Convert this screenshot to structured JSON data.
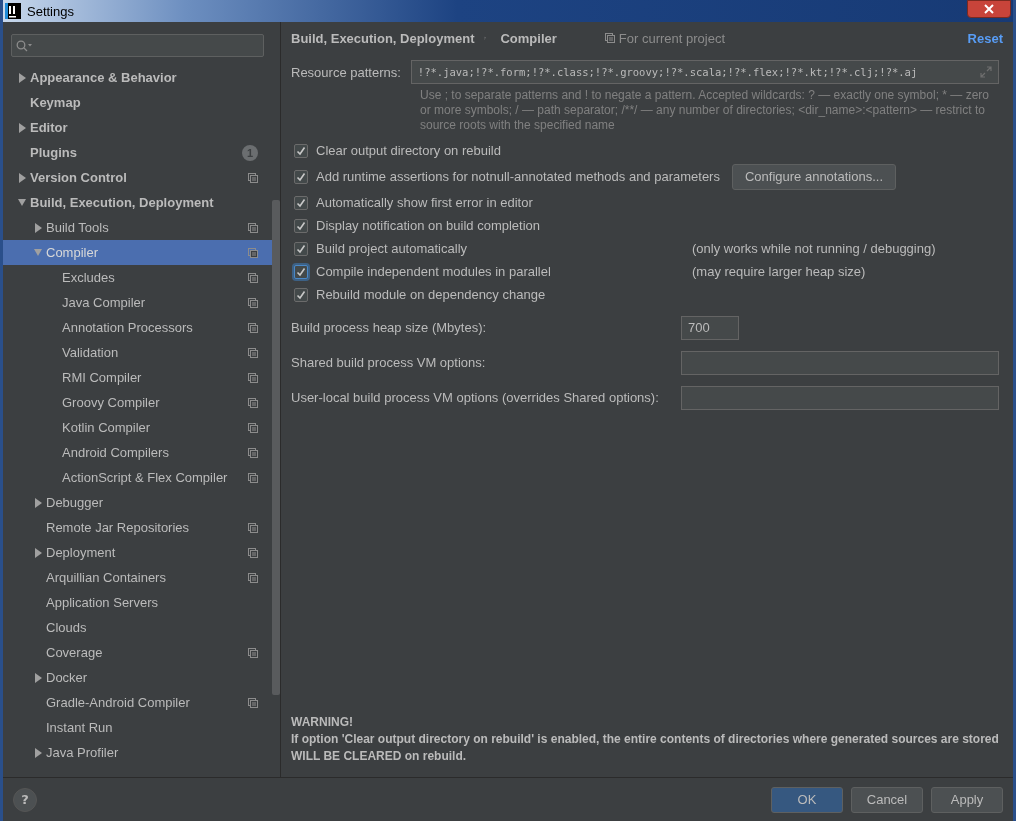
{
  "window": {
    "title": "Settings"
  },
  "sidebar": {
    "items": [
      {
        "label": "Appearance & Behavior",
        "expanded": false,
        "selected": false
      },
      {
        "label": "Keymap",
        "selected": false
      },
      {
        "label": "Editor",
        "expanded": false,
        "selected": false
      },
      {
        "label": "Plugins",
        "badge": "1",
        "selected": false
      },
      {
        "label": "Version Control",
        "expanded": false,
        "per_project": true,
        "selected": false
      },
      {
        "label": "Build, Execution, Deployment",
        "expanded": true,
        "selected": false,
        "children": [
          {
            "label": "Build Tools",
            "expanded": false,
            "per_project": true,
            "selected": false
          },
          {
            "label": "Compiler",
            "expanded": true,
            "per_project": true,
            "selected": true,
            "children": [
              {
                "label": "Excludes",
                "per_project": true,
                "selected": false
              },
              {
                "label": "Java Compiler",
                "per_project": true,
                "selected": false
              },
              {
                "label": "Annotation Processors",
                "per_project": true,
                "selected": false
              },
              {
                "label": "Validation",
                "per_project": true,
                "selected": false
              },
              {
                "label": "RMI Compiler",
                "per_project": true,
                "selected": false
              },
              {
                "label": "Groovy Compiler",
                "per_project": true,
                "selected": false
              },
              {
                "label": "Kotlin Compiler",
                "per_project": true,
                "selected": false
              },
              {
                "label": "Android Compilers",
                "per_project": true,
                "selected": false
              },
              {
                "label": "ActionScript & Flex Compiler",
                "per_project": true,
                "selected": false
              }
            ]
          },
          {
            "label": "Debugger",
            "expanded": false,
            "selected": false
          },
          {
            "label": "Remote Jar Repositories",
            "per_project": true,
            "selected": false
          },
          {
            "label": "Deployment",
            "expanded": false,
            "per_project": true,
            "selected": false
          },
          {
            "label": "Arquillian Containers",
            "per_project": true,
            "selected": false
          },
          {
            "label": "Application Servers",
            "selected": false
          },
          {
            "label": "Clouds",
            "selected": false
          },
          {
            "label": "Coverage",
            "per_project": true,
            "selected": false
          },
          {
            "label": "Docker",
            "expanded": false,
            "selected": false
          },
          {
            "label": "Gradle-Android Compiler",
            "per_project": true,
            "selected": false
          },
          {
            "label": "Instant Run",
            "selected": false
          },
          {
            "label": "Java Profiler",
            "expanded": false,
            "selected": false
          }
        ]
      }
    ]
  },
  "breadcrumb": [
    "Build, Execution, Deployment",
    "Compiler"
  ],
  "scope": "For current project",
  "reset": "Reset",
  "resource_patterns": {
    "label": "Resource patterns:",
    "value": "!?*.java;!?*.form;!?*.class;!?*.groovy;!?*.scala;!?*.flex;!?*.kt;!?*.clj;!?*.aj",
    "hint": "Use ; to separate patterns and ! to negate a pattern. Accepted wildcards: ? — exactly one symbol; * — zero or more symbols; / — path separator; /**/ — any number of directories; <dir_name>:<pattern> — restrict to source roots with the specified name"
  },
  "options": [
    {
      "label": "Clear output directory on rebuild",
      "checked": true,
      "focused": false
    },
    {
      "label": "Add runtime assertions for notnull-annotated methods and parameters",
      "checked": true,
      "focused": false,
      "button": "Configure annotations..."
    },
    {
      "label": "Automatically show first error in editor",
      "checked": true,
      "focused": false
    },
    {
      "label": "Display notification on build completion",
      "checked": true,
      "focused": false
    },
    {
      "label": "Build project automatically",
      "checked": true,
      "focused": false,
      "note": "(only works while not running / debugging)"
    },
    {
      "label": "Compile independent modules in parallel",
      "checked": true,
      "focused": true,
      "note": "(may require larger heap size)"
    },
    {
      "label": "Rebuild module on dependency change",
      "checked": true,
      "focused": false
    }
  ],
  "fields": [
    {
      "label": "Build process heap size (Mbytes):",
      "value": "700",
      "kind": "short"
    },
    {
      "label": "Shared build process VM options:",
      "kind": "wide"
    },
    {
      "label": "User-local build process VM options (overrides Shared options):",
      "kind": "wide"
    }
  ],
  "warning": {
    "title": "WARNING!",
    "text": "If option 'Clear output directory on rebuild' is enabled, the entire contents of directories where generated sources are stored WILL BE CLEARED on rebuild."
  },
  "help": "?",
  "buttons": [
    {
      "label": "OK",
      "default": true
    },
    {
      "label": "Cancel",
      "default": false
    },
    {
      "label": "Apply",
      "default": false
    }
  ]
}
